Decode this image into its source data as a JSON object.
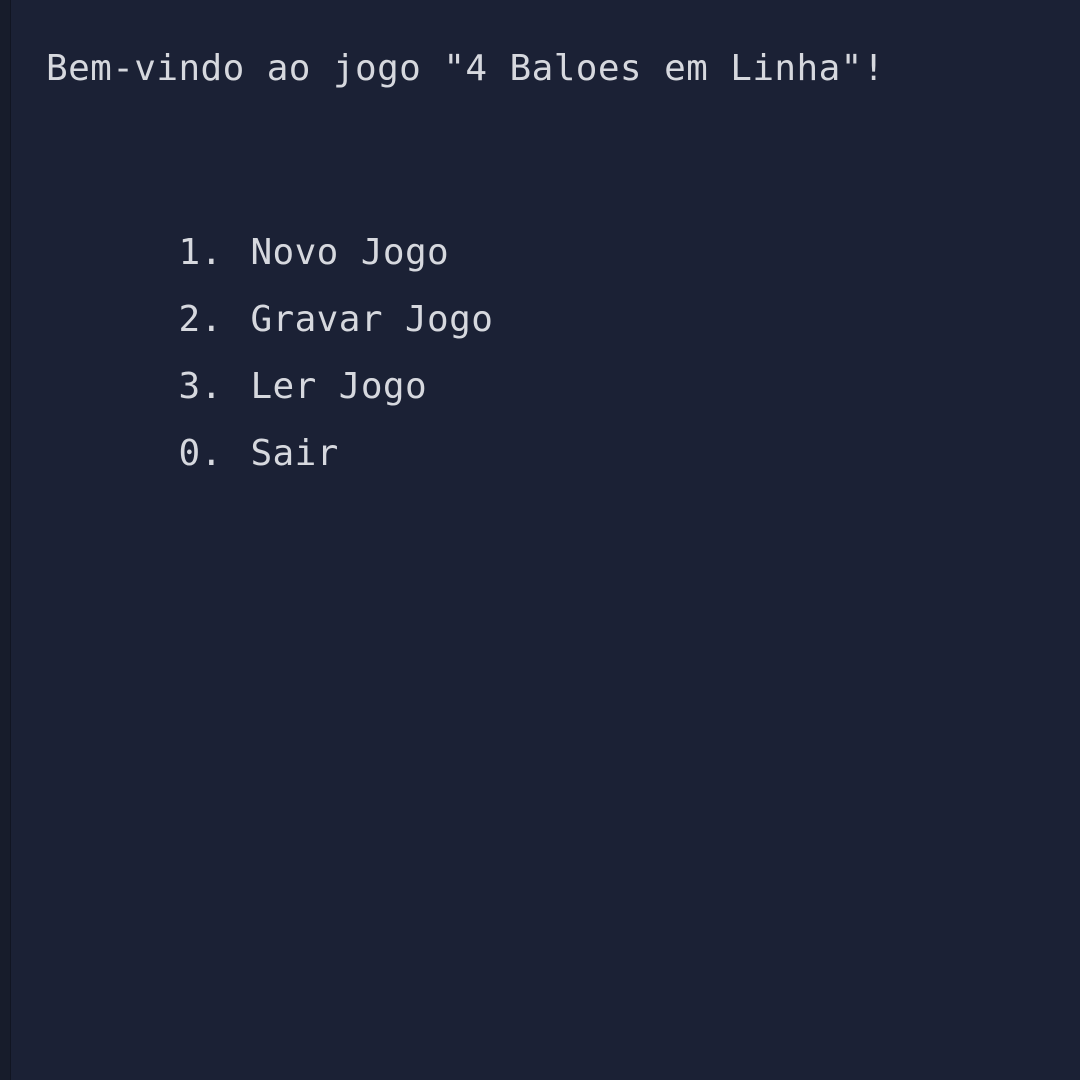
{
  "console": {
    "welcome": "Bem-vindo ao jogo \"4 Baloes em Linha\"!",
    "menu": [
      {
        "number": "1.",
        "label": "Novo Jogo"
      },
      {
        "number": "2.",
        "label": "Gravar Jogo"
      },
      {
        "number": "3.",
        "label": "Ler Jogo"
      },
      {
        "number": "0.",
        "label": "Sair"
      }
    ]
  },
  "colors": {
    "background": "#1b2135",
    "text": "#d6d8de"
  }
}
